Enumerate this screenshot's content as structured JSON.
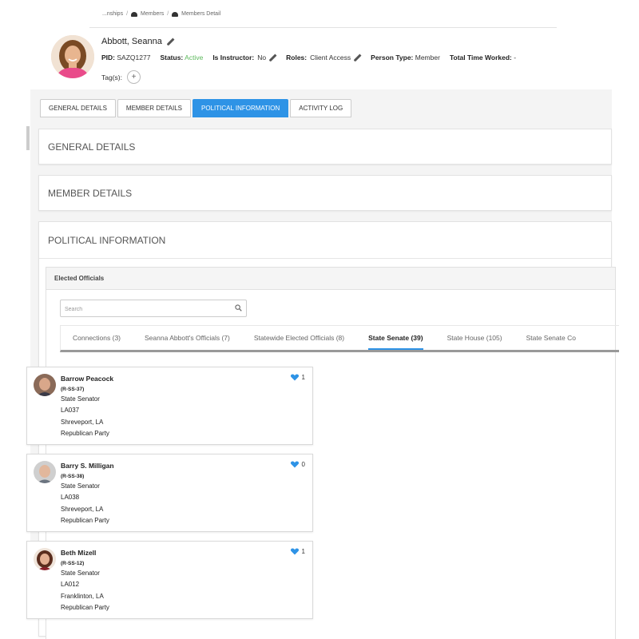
{
  "breadcrumb": {
    "item1": "...nships",
    "item2": "Members",
    "item3": "Members Detail"
  },
  "profile": {
    "name": "Abbott, Seanna",
    "pid_label": "PID:",
    "pid": "SAZQ1277",
    "status_label": "Status:",
    "status": "Active",
    "instructor_label": "Is Instructor:",
    "instructor": "No",
    "roles_label": "Roles:",
    "roles": "Client Access",
    "person_type_label": "Person Type:",
    "person_type": "Member",
    "time_label": "Total Time Worked:",
    "time": "-",
    "tags_label": "Tag(s):",
    "tag_add": "+"
  },
  "main_tabs": [
    "GENERAL DETAILS",
    "MEMBER DETAILS",
    "POLITICAL INFORMATION",
    "ACTIVITY LOG"
  ],
  "sections": {
    "general": "GENERAL DETAILS",
    "member": "MEMBER DETAILS",
    "political": "POLITICAL INFORMATION"
  },
  "elected": {
    "title": "Elected Officials",
    "search_placeholder": "Search",
    "tabs": [
      "Connections (3)",
      "Seanna Abbott's Officials (7)",
      "Statewide Elected Officials (8)",
      "State Senate (39)",
      "State House (105)",
      "State Senate Co"
    ],
    "active_tab": "State Senate (39)"
  },
  "officials": [
    {
      "name": "Barrow Peacock",
      "code": "(R-SS-37)",
      "title": "State Senator",
      "district": "LA037",
      "city": "Shreveport, LA",
      "party": "Republican Party",
      "likes": "1"
    },
    {
      "name": "Barry S. Milligan",
      "code": "(R-SS-38)",
      "title": "State Senator",
      "district": "LA038",
      "city": "Shreveport, LA",
      "party": "Republican Party",
      "likes": "0"
    },
    {
      "name": "Beth Mizell",
      "code": "(R-SS-12)",
      "title": "State Senator",
      "district": "LA012",
      "city": "Franklinton, LA",
      "party": "Republican Party",
      "likes": "1"
    }
  ],
  "colors": {
    "accent": "#2e93e6",
    "active_status": "#5cb85c",
    "heart": "#2e93e6"
  }
}
